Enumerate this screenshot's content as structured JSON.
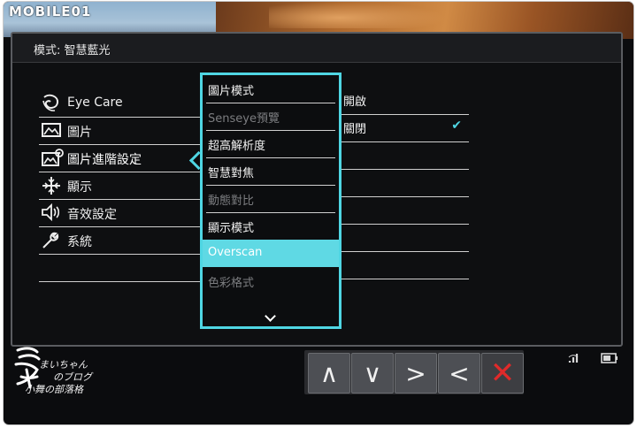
{
  "brand": "MOBILE01",
  "osd": {
    "title": "模式: 智慧藍光"
  },
  "menu": [
    {
      "label": "Eye Care",
      "icon": "eye-care-icon"
    },
    {
      "label": "圖片",
      "icon": "picture-icon"
    },
    {
      "label": "圖片進階設定",
      "icon": "picture-advanced-icon",
      "active": true
    },
    {
      "label": "顯示",
      "icon": "display-icon"
    },
    {
      "label": "音效設定",
      "icon": "audio-icon"
    },
    {
      "label": "系統",
      "icon": "system-wrench-icon"
    },
    {
      "label": "",
      "icon": ""
    }
  ],
  "submenu": [
    {
      "label": "圖片模式",
      "state": "normal"
    },
    {
      "label": "Senseye預覽",
      "state": "disabled"
    },
    {
      "label": "超高解析度",
      "state": "normal"
    },
    {
      "label": "智慧對焦",
      "state": "normal"
    },
    {
      "label": "動態對比",
      "state": "disabled"
    },
    {
      "label": "顯示模式",
      "state": "normal"
    },
    {
      "label": "Overscan",
      "state": "selected"
    },
    {
      "label": "色彩格式",
      "state": "disabled"
    }
  ],
  "options": [
    {
      "label": "開啟",
      "checked": false
    },
    {
      "label": "關閉",
      "checked": true
    },
    {
      "label": "",
      "checked": false
    },
    {
      "label": "",
      "checked": false
    },
    {
      "label": "",
      "checked": false
    },
    {
      "label": "",
      "checked": false
    },
    {
      "label": "",
      "checked": false
    }
  ],
  "controls": {
    "up": "∧",
    "down": "∨",
    "right": ">",
    "left": "<",
    "close": "✕"
  },
  "watermark": {
    "line1": "まいちゃん",
    "line2": "のブログ",
    "line3": "小舞の部落格"
  },
  "colors": {
    "accent": "#4fd6e3",
    "selected_bg": "#5fd9e4",
    "close": "#e02a2a"
  }
}
